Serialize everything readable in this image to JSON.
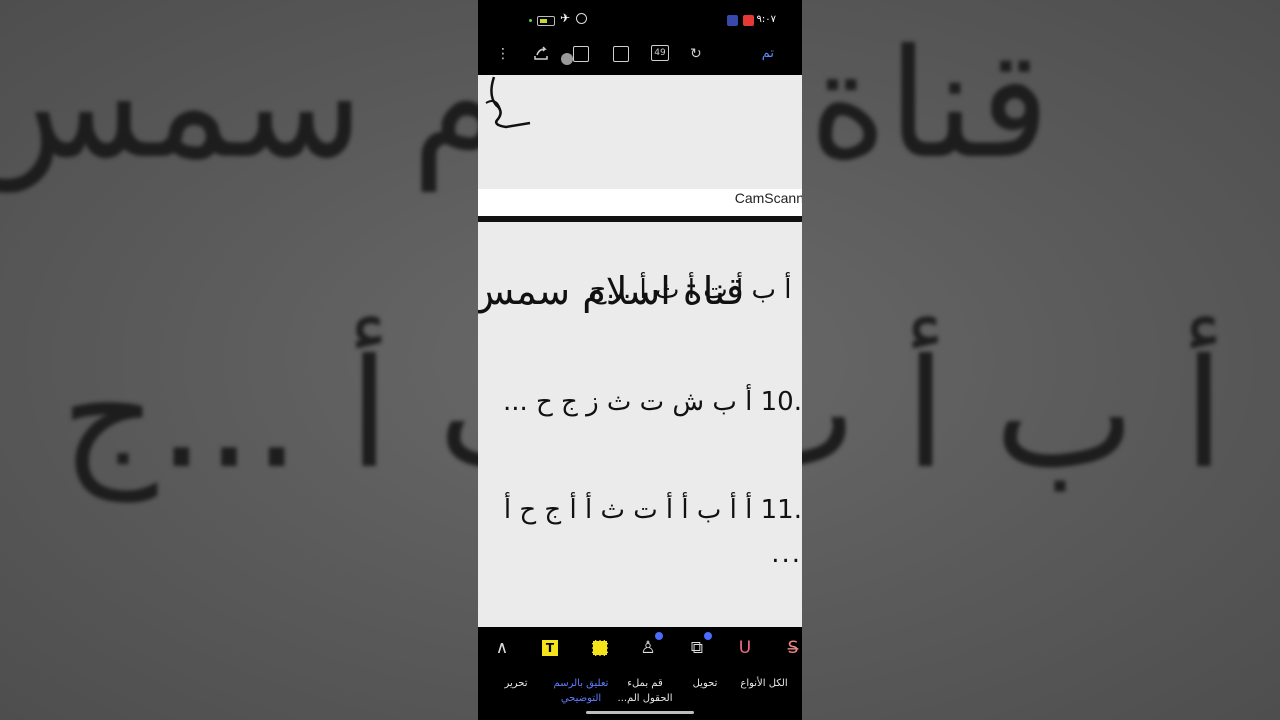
{
  "background": {
    "title_text": "قناة اسلام سمس",
    "line_text": ". أ ب أ ت أ ث أ ...ج"
  },
  "status_bar": {
    "time": "٩:٠٧",
    "battery_color": "#c8d43a"
  },
  "toolbar": {
    "done_label": "تم",
    "page_count": "49",
    "icons": [
      "more-vert-icon",
      "share-icon",
      "reader-icon",
      "crop-icon",
      "page-count-icon",
      "redo-icon"
    ]
  },
  "document": {
    "watermark": "CamScann",
    "title": "قناة اسلام سمس",
    "lines": [
      ". أ ب أ ت أ ث أ ...ج",
      ".10   أ ب ش ت ث ز ج ح ...",
      ".11   أ أ ب أ أ ت ث أ أ ج ح أ",
      "..."
    ]
  },
  "bottom_toolbar": {
    "tools": [
      "strikethrough-icon",
      "underline-icon",
      "shape-icon",
      "stamp-icon",
      "area-highlight-icon",
      "text-highlight-icon",
      "pen-icon"
    ],
    "tabs": [
      {
        "label": "الكل الأنواع",
        "active": false
      },
      {
        "label": "تحويل",
        "active": false
      },
      {
        "label": "قم بملء الحقول الم...",
        "active": false
      },
      {
        "label": "تعليق بالرسم التوضيحي",
        "active": true
      },
      {
        "label": "تحرير",
        "active": false
      }
    ],
    "accent_color": "#5f7dff",
    "highlight_color": "#f2e31a"
  }
}
